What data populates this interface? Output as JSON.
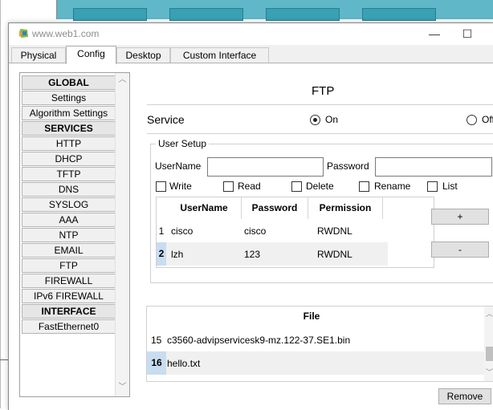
{
  "window": {
    "title": "www.web1.com",
    "minimize": "—",
    "maximize": "☐"
  },
  "tabs": [
    "Physical",
    "Config",
    "Desktop",
    "Custom Interface"
  ],
  "sidebar": {
    "items": [
      {
        "label": "GLOBAL",
        "header": true
      },
      {
        "label": "Settings",
        "header": false
      },
      {
        "label": "Algorithm Settings",
        "header": false
      },
      {
        "label": "SERVICES",
        "header": true
      },
      {
        "label": "HTTP",
        "header": false
      },
      {
        "label": "DHCP",
        "header": false
      },
      {
        "label": "TFTP",
        "header": false
      },
      {
        "label": "DNS",
        "header": false
      },
      {
        "label": "SYSLOG",
        "header": false
      },
      {
        "label": "AAA",
        "header": false
      },
      {
        "label": "NTP",
        "header": false
      },
      {
        "label": "EMAIL",
        "header": false
      },
      {
        "label": "FTP",
        "header": false
      },
      {
        "label": "FIREWALL",
        "header": false
      },
      {
        "label": "IPv6 FIREWALL",
        "header": false
      },
      {
        "label": "INTERFACE",
        "header": true
      },
      {
        "label": "FastEthernet0",
        "header": false
      }
    ]
  },
  "ftp": {
    "title": "FTP",
    "service": {
      "label": "Service",
      "on_label": "On",
      "off_label": "Off",
      "selected": "On"
    },
    "user_setup": {
      "title": "User Setup",
      "username_label": "UserName",
      "username_value": "",
      "password_label": "Password",
      "password_value": "",
      "permissions": [
        "Write",
        "Read",
        "Delete",
        "Rename",
        "List"
      ],
      "table": {
        "headers": [
          "UserName",
          "Password",
          "Permission"
        ],
        "rows": [
          {
            "index": "1",
            "username": "cisco",
            "password": "cisco",
            "permission": "RWDNL"
          },
          {
            "index": "2",
            "username": "lzh",
            "password": "123",
            "permission": "RWDNL"
          }
        ]
      },
      "add_label": "+",
      "remove_label": "-"
    },
    "files": {
      "header": "File",
      "rows": [
        {
          "index": "15",
          "name": "c3560-advipservicesk9-mz.122-37.SE1.bin"
        },
        {
          "index": "16",
          "name": "hello.txt"
        }
      ]
    },
    "remove_file_label": "Remove"
  }
}
